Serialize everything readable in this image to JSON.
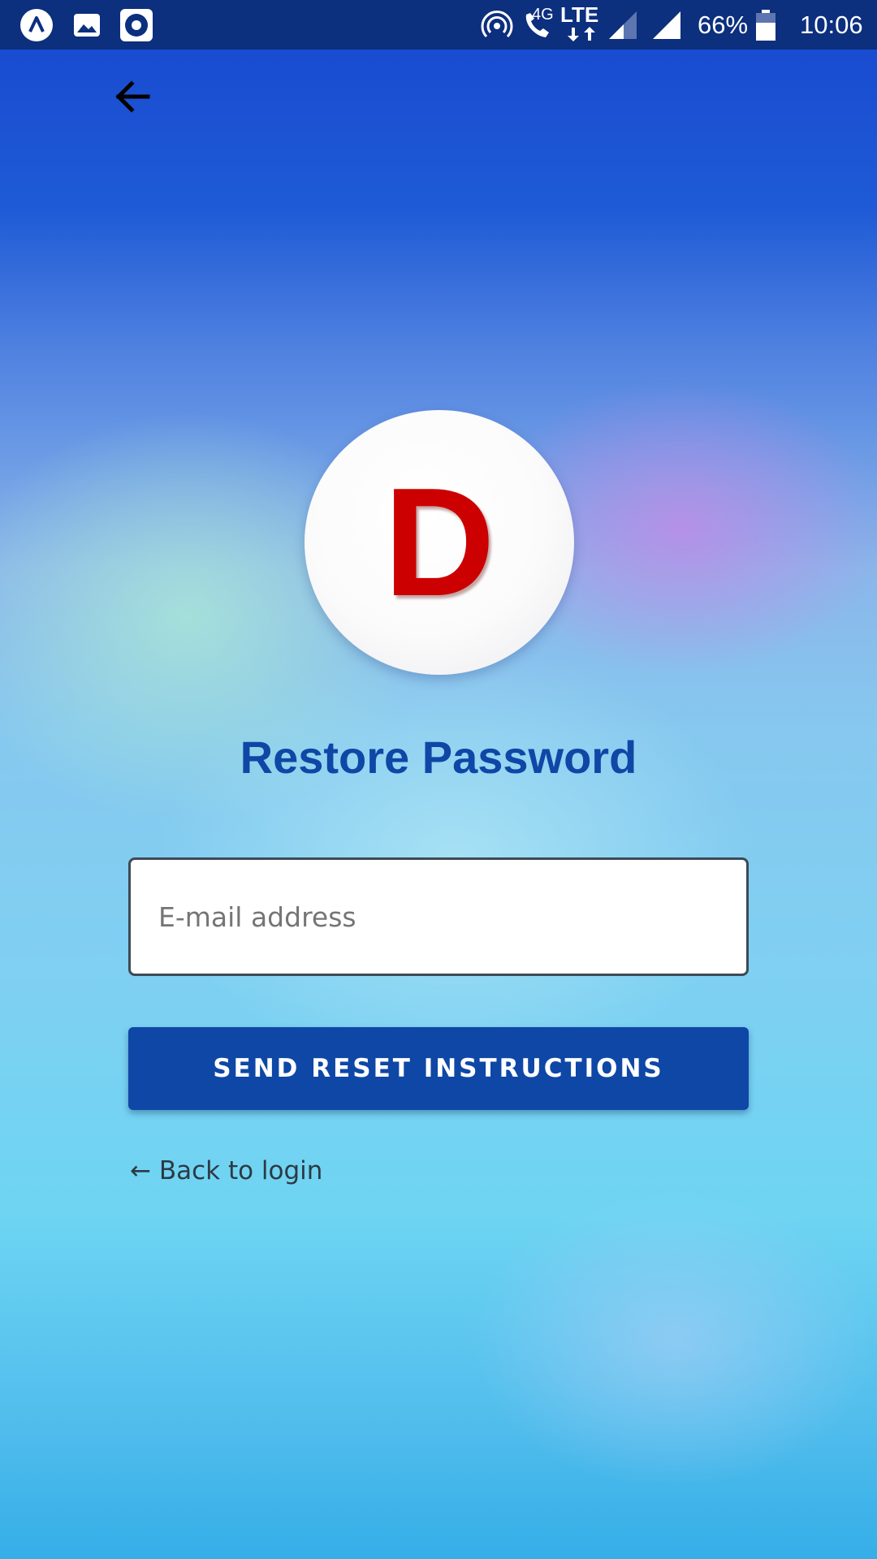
{
  "status_bar": {
    "battery": "66%",
    "time": "10:06",
    "network_4g": "4G",
    "network_lte": "LTE",
    "icons": [
      "app-a-icon",
      "image-icon",
      "record-icon",
      "hotspot-icon",
      "wifi-call-icon",
      "lte-icon",
      "signal-icon",
      "signal-icon",
      "battery-icon"
    ]
  },
  "header": {
    "back_icon": "arrow-left-icon"
  },
  "logo": {
    "letter": "D",
    "color": "#cc0000"
  },
  "page": {
    "title": "Restore Password",
    "email_placeholder": "E-mail address",
    "email_value": "",
    "send_button": "SEND RESET INSTRUCTIONS",
    "back_link": "← Back to login"
  },
  "colors": {
    "primary": "#0e47a6",
    "status_bar": "#0c2f7e"
  }
}
